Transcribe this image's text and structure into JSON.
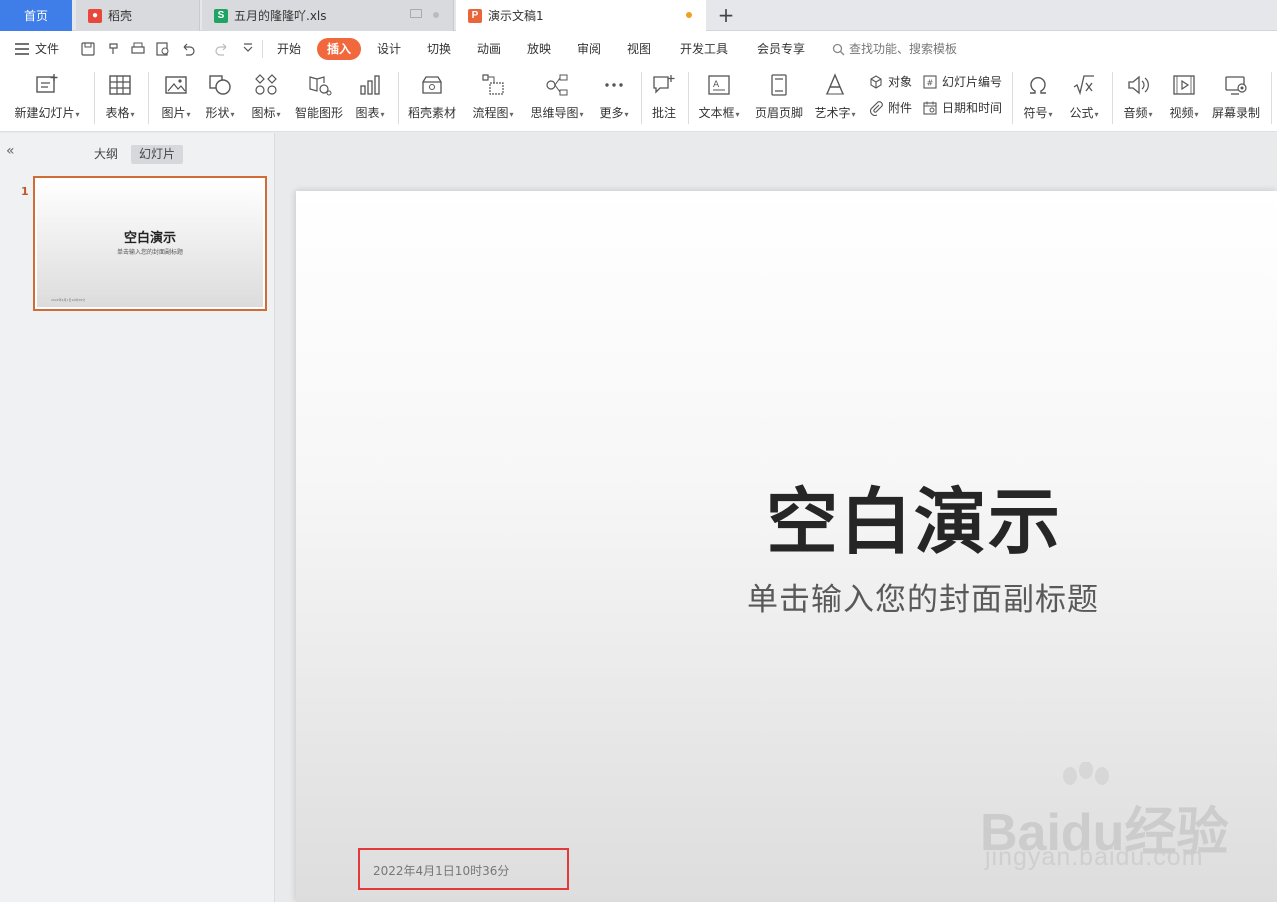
{
  "tabs": [
    {
      "label": "首页"
    },
    {
      "label": "稻壳"
    },
    {
      "label": "五月的隆隆吖.xls"
    },
    {
      "label": "演示文稿1"
    }
  ],
  "menu": {
    "file": "文件",
    "items": [
      "开始",
      "插入",
      "设计",
      "切换",
      "动画",
      "放映",
      "审阅",
      "视图",
      "开发工具",
      "会员专享"
    ],
    "active": "插入",
    "search_placeholder": "查找功能、搜索模板"
  },
  "ribbon": {
    "new_slide": "新建幻灯片",
    "table": "表格",
    "picture": "图片",
    "shape": "形状",
    "icon": "图标",
    "smart_graphic": "智能图形",
    "chart": "图表",
    "daoke_material": "稻壳素材",
    "flowchart": "流程图",
    "mindmap": "思维导图",
    "more": "更多",
    "comment": "批注",
    "textbox": "文本框",
    "header_footer": "页眉页脚",
    "wordart": "艺术字",
    "object": "对象",
    "attachment": "附件",
    "slide_number": "幻灯片编号",
    "datetime": "日期和时间",
    "symbol": "符号",
    "formula": "公式",
    "audio": "音频",
    "video": "视频",
    "screen_record": "屏幕录制"
  },
  "panel": {
    "outline_tab": "大纲",
    "slides_tab": "幻灯片",
    "slide_number": "1"
  },
  "slide": {
    "title": "空白演示",
    "subtitle": "单击输入您的封面副标题",
    "date": "2022年4月1日10时36分"
  },
  "watermark": {
    "logo": "Baidu经验",
    "url": "jingyan.baidu.com"
  },
  "colors": {
    "accent": "#f1683c",
    "home_tab": "#3f7ee8",
    "highlight_box": "#e03a3a"
  }
}
